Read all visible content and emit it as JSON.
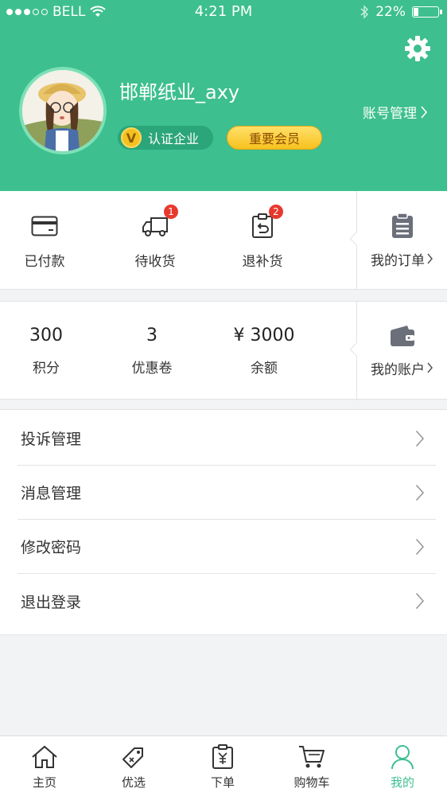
{
  "status": {
    "carrier": "BELL",
    "time": "4:21 PM",
    "battery": "22%",
    "battery_level": 0.22
  },
  "profile": {
    "username": "邯郸纸业_axy",
    "cert_badge": "认证企业",
    "cert_icon_letter": "V",
    "vip_badge": "重要会员",
    "account_manage": "账号管理"
  },
  "orders": {
    "items": [
      {
        "label": "已付款",
        "icon": "card-icon",
        "badge": ""
      },
      {
        "label": "待收货",
        "icon": "truck-icon",
        "badge": "1"
      },
      {
        "label": "退补货",
        "icon": "return-icon",
        "badge": "2"
      }
    ],
    "my_orders": {
      "label": "我的订单",
      "icon": "clipboard-icon"
    }
  },
  "stats": {
    "items": [
      {
        "value": "300",
        "label": "积分"
      },
      {
        "value": "3",
        "label": "优惠卷"
      },
      {
        "value": "¥ 3000",
        "label": "余额"
      }
    ],
    "my_account": {
      "label": "我的账户",
      "icon": "wallet-icon"
    }
  },
  "menu": [
    {
      "label": "投诉管理"
    },
    {
      "label": "消息管理"
    },
    {
      "label": "修改密码"
    },
    {
      "label": "退出登录"
    }
  ],
  "tabs": [
    {
      "label": "主页",
      "icon": "home-icon"
    },
    {
      "label": "优选",
      "icon": "tag-icon"
    },
    {
      "label": "下单",
      "icon": "order-icon"
    },
    {
      "label": "购物车",
      "icon": "cart-icon"
    },
    {
      "label": "我的",
      "icon": "user-icon",
      "active": true
    }
  ],
  "colors": {
    "brand_green": "#3dbf8f",
    "badge_red": "#e8392e",
    "vip_gold": "#f7c11e"
  }
}
